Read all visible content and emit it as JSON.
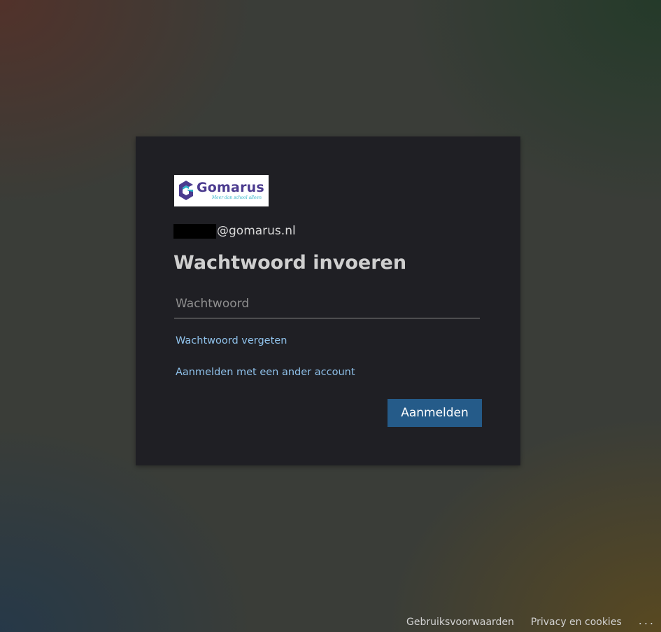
{
  "brand": {
    "logo_text": "Gomarus",
    "logo_tagline": "Meer dan school alleen",
    "colors": {
      "primary": "#4b3b8f",
      "accent": "#2bb3c8"
    }
  },
  "login": {
    "account_domain": "@gomarus.nl",
    "title": "Wachtwoord invoeren",
    "password_placeholder": "Wachtwoord",
    "password_value": "",
    "forgot_password": "Wachtwoord vergeten",
    "other_account": "Aanmelden met een ander account",
    "submit": "Aanmelden",
    "button_color": "#255b89",
    "link_color": "#8fc1ea"
  },
  "footer": {
    "terms": "Gebruiksvoorwaarden",
    "privacy": "Privacy en cookies",
    "more": "..."
  }
}
